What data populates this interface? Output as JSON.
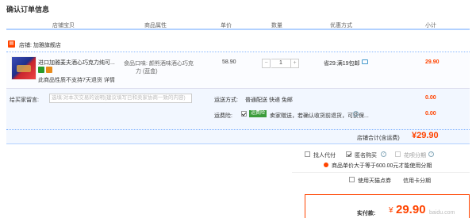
{
  "page": {
    "title": "确认订单信息"
  },
  "columns": [
    "店铺宝贝",
    "商品属性",
    "单价",
    "数量",
    "优惠方式",
    "小计"
  ],
  "shop": {
    "icon": "shop-icon",
    "label": "店铺: 加雅旗舰店"
  },
  "item": {
    "title_line1": "进口加雅麦夫酒心巧克力纯可...",
    "title_line2": "",
    "notice": "此商品性质不支持7天退货 详情",
    "attr_line1": "食品口味: 颜熊酒味酒心巧克",
    "attr_line2": "力 (蓝盒)",
    "price": "58.90",
    "quantity": "1",
    "minus": "−",
    "plus": "+",
    "promo": "省29:满19包邮",
    "subtotal": "29.90"
  },
  "message": {
    "label": "给买家留言:",
    "placeholder": "选填:对本次交易的说明(建议填写已和卖家协商一致的内容)"
  },
  "shipping": {
    "label": "运送方式:",
    "value": "普通配送 快递 免邮",
    "price": "0.00"
  },
  "insurance": {
    "label": "运费险:",
    "tag": "运费险",
    "text": "卖家赠送，若确认收货前退货，可获保...",
    "price": "0.00"
  },
  "shop_total": {
    "label": "店铺合计(含运费)",
    "value": "¥29.90"
  },
  "options": {
    "proxy_pay": "找人代付",
    "anonymous": "匿名购买",
    "huabei": "花呗分期",
    "notice": "商品单价大于等于600.00元才能使用分期",
    "cash": "使用天猫点券",
    "installment": "信用卡分期"
  },
  "payment": {
    "label": "实付款:",
    "yen": "¥",
    "value": "29.90"
  },
  "watermark": "baidu.com",
  "colors": {
    "accent": "#ff4400",
    "header_border": "#b2d1ff",
    "row_bg": "#f2f7ff"
  }
}
